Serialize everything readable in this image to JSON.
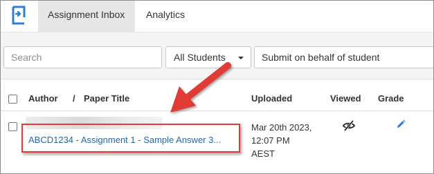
{
  "nav": {
    "tabs": [
      {
        "label": "Assignment Inbox"
      },
      {
        "label": "Analytics"
      }
    ]
  },
  "filters": {
    "search_placeholder": "Search",
    "students_select": "All Students",
    "submit_behalf": "Submit on behalf of student"
  },
  "table": {
    "headers": {
      "author": "Author",
      "slash": "/",
      "paper_title": "Paper Title",
      "uploaded": "Uploaded",
      "viewed": "Viewed",
      "grade": "Grade"
    },
    "rows": [
      {
        "paper_title": "ABCD1234 - Assignment 1 - Sample Answer 3...",
        "uploaded": [
          "Mar 20th 2023,",
          "12:07 PM",
          "AEST"
        ],
        "viewed_icon": "eye-slash-icon",
        "grade_icon": "pencil-icon"
      }
    ]
  },
  "colors": {
    "accent": "#2767a8",
    "annotation": "#e03b36",
    "active_tab": "#e6e6e6"
  }
}
